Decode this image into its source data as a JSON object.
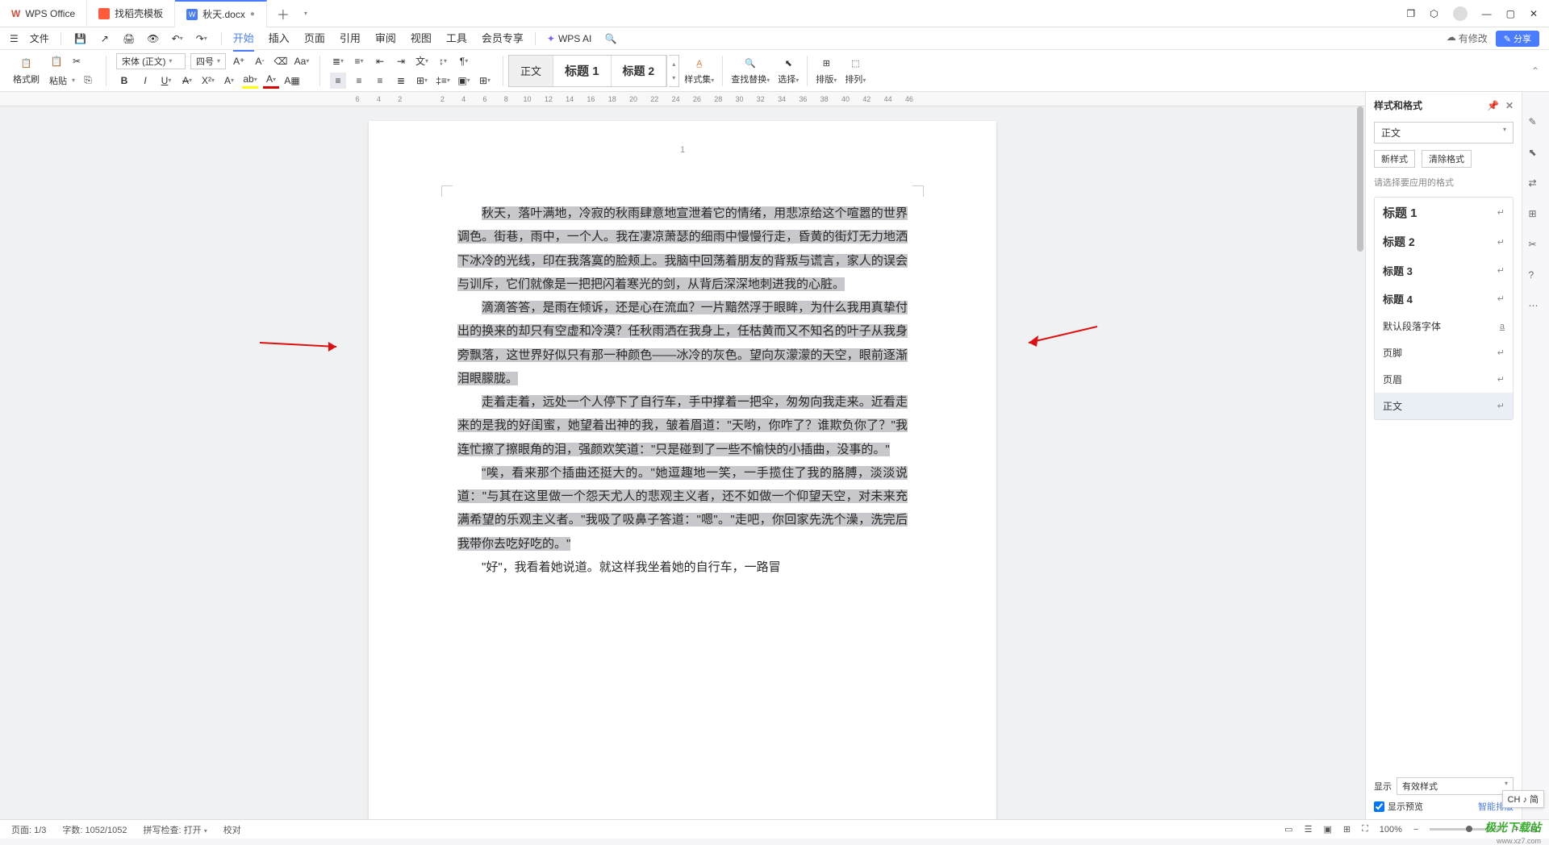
{
  "tabs": {
    "t1": "WPS Office",
    "t2": "找稻壳模板",
    "t3": "秋天.docx"
  },
  "menubar": {
    "file": "文件",
    "tabs": [
      "开始",
      "插入",
      "页面",
      "引用",
      "审阅",
      "视图",
      "工具",
      "会员专享"
    ],
    "ai": "WPS AI",
    "modified": "有修改",
    "share": "分享"
  },
  "ribbon": {
    "format_painter": "格式刷",
    "paste": "粘贴",
    "font_name": "宋体 (正文)",
    "font_size": "四号",
    "styles": {
      "normal": "正文",
      "h1": "标题 1",
      "h2": "标题 2"
    },
    "style_set": "样式集",
    "find_replace": "查找替换",
    "select": "选择",
    "layout": "排版",
    "arrange": "排列"
  },
  "ruler_numbers": [
    "6",
    "4",
    "2",
    "",
    "2",
    "4",
    "6",
    "8",
    "10",
    "12",
    "14",
    "16",
    "18",
    "20",
    "22",
    "24",
    "26",
    "28",
    "30",
    "32",
    "34",
    "36",
    "38",
    "40",
    "42",
    "44",
    "46"
  ],
  "page_number": "1",
  "document": {
    "p1": "秋天，落叶满地，冷寂的秋雨肆意地宣泄着它的情绪，用悲凉给这个喧嚣的世界调色。街巷，雨中，一个人。我在凄凉萧瑟的细雨中慢慢行走，昏黄的街灯无力地洒下冰冷的光线，印在我落寞的脸颊上。我脑中回荡着朋友的背叛与谎言，家人的误会与训斥，它们就像是一把把闪着寒光的剑，从背后深深地刺进我的心脏。",
    "p2": "滴滴答答，是雨在倾诉，还是心在流血？一片黯然浮于眼眸，为什么我用真挚付出的换来的却只有空虚和冷漠？任秋雨洒在我身上，任枯黄而又不知名的叶子从我身旁飘落，这世界好似只有那一种颜色——冰冷的灰色。望向灰濛濛的天空，眼前逐渐泪眼朦胧。",
    "p3a": "走着走着，远处一个人停下了自行车，手中撑着一把伞，匆匆向我走来。近看走来的是我的好闺蜜，她望着出神的我，皱着眉道：\"天哟，你咋了？谁欺负你了？\"我连忙擦了擦眼角的泪，强颜欢笑道：\"只是碰到了一些不愉快的小插曲，没事的。\"",
    "p3b": "\"唉，看来那个插曲还挺大的。\"她逗趣地一笑，一手揽住了我的胳膊，淡淡说道：\"与其在这里做一个怨天尤人的悲观主义者，还不如做一个仰望天空，对未来充满希望的乐观主义者。\"我吸了吸鼻子答道：\"嗯\"。\"走吧，你回家先洗个澡，洗完后我带你去吃好吃的。\"",
    "p4": "\"好\"，我看着她说道。就这样我坐着她的自行车，一路冒"
  },
  "side_panel": {
    "title": "样式和格式",
    "current_style": "正文",
    "new_style": "新样式",
    "clear_format": "清除格式",
    "hint": "请选择要应用的格式",
    "items": {
      "h1": "标题 1",
      "h2": "标题 2",
      "h3": "标题 3",
      "h4": "标题 4",
      "default_font": "默认段落字体",
      "footer": "页脚",
      "header": "页眉",
      "normal": "正文"
    },
    "show_label": "显示",
    "show_value": "有效样式",
    "preview": "显示预览",
    "smart_layout": "智能排版"
  },
  "statusbar": {
    "page": "页面: 1/3",
    "words": "字数: 1052/1052",
    "spell": "拼写检查: 打开",
    "proof": "校对",
    "zoom": "100%"
  },
  "ime": "CH ♪ 简",
  "watermark": "极光下载站",
  "watermark_url": "www.xz7.com"
}
